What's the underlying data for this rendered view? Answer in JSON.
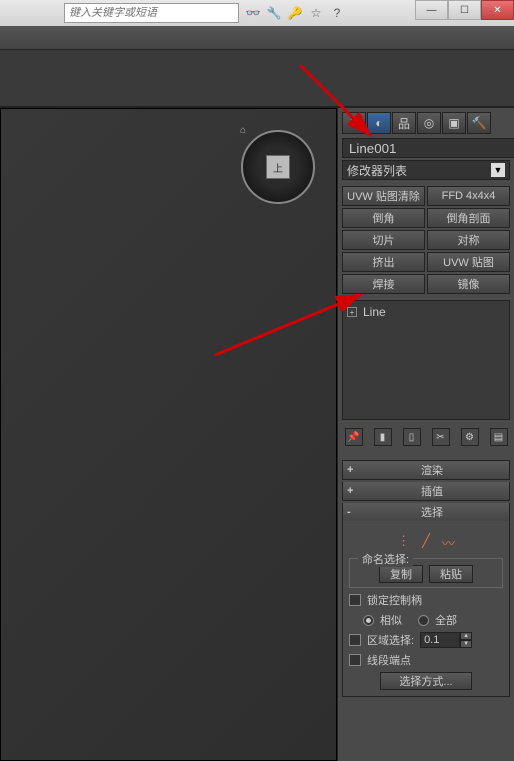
{
  "titlebar": {
    "search_placeholder": "键入关键字或短语"
  },
  "object_name": "Line001",
  "modifier_dropdown": "修改器列表",
  "modifier_buttons": {
    "uvw_clear": "UVW 贴图清除",
    "ffd": "FFD 4x4x4",
    "chamfer": "倒角",
    "chamfer_profile": "倒角剖面",
    "slice": "切片",
    "symmetry": "对称",
    "extrude": "挤出",
    "uvw_map": "UVW 贴图",
    "weld": "焊接",
    "mirror": "镜像"
  },
  "stack_item": "Line",
  "rollouts": {
    "render": "渲染",
    "interp": "插值",
    "select": "选择"
  },
  "named_selection": {
    "legend": "命名选择:",
    "copy": "复制",
    "paste": "粘贴"
  },
  "lock_handles": "锁定控制柄",
  "radio_similar": "相似",
  "radio_all": "全部",
  "area_select": "区域选择:",
  "area_value": "0.1",
  "segment_end": "线段端点",
  "select_mode": "选择方式..."
}
